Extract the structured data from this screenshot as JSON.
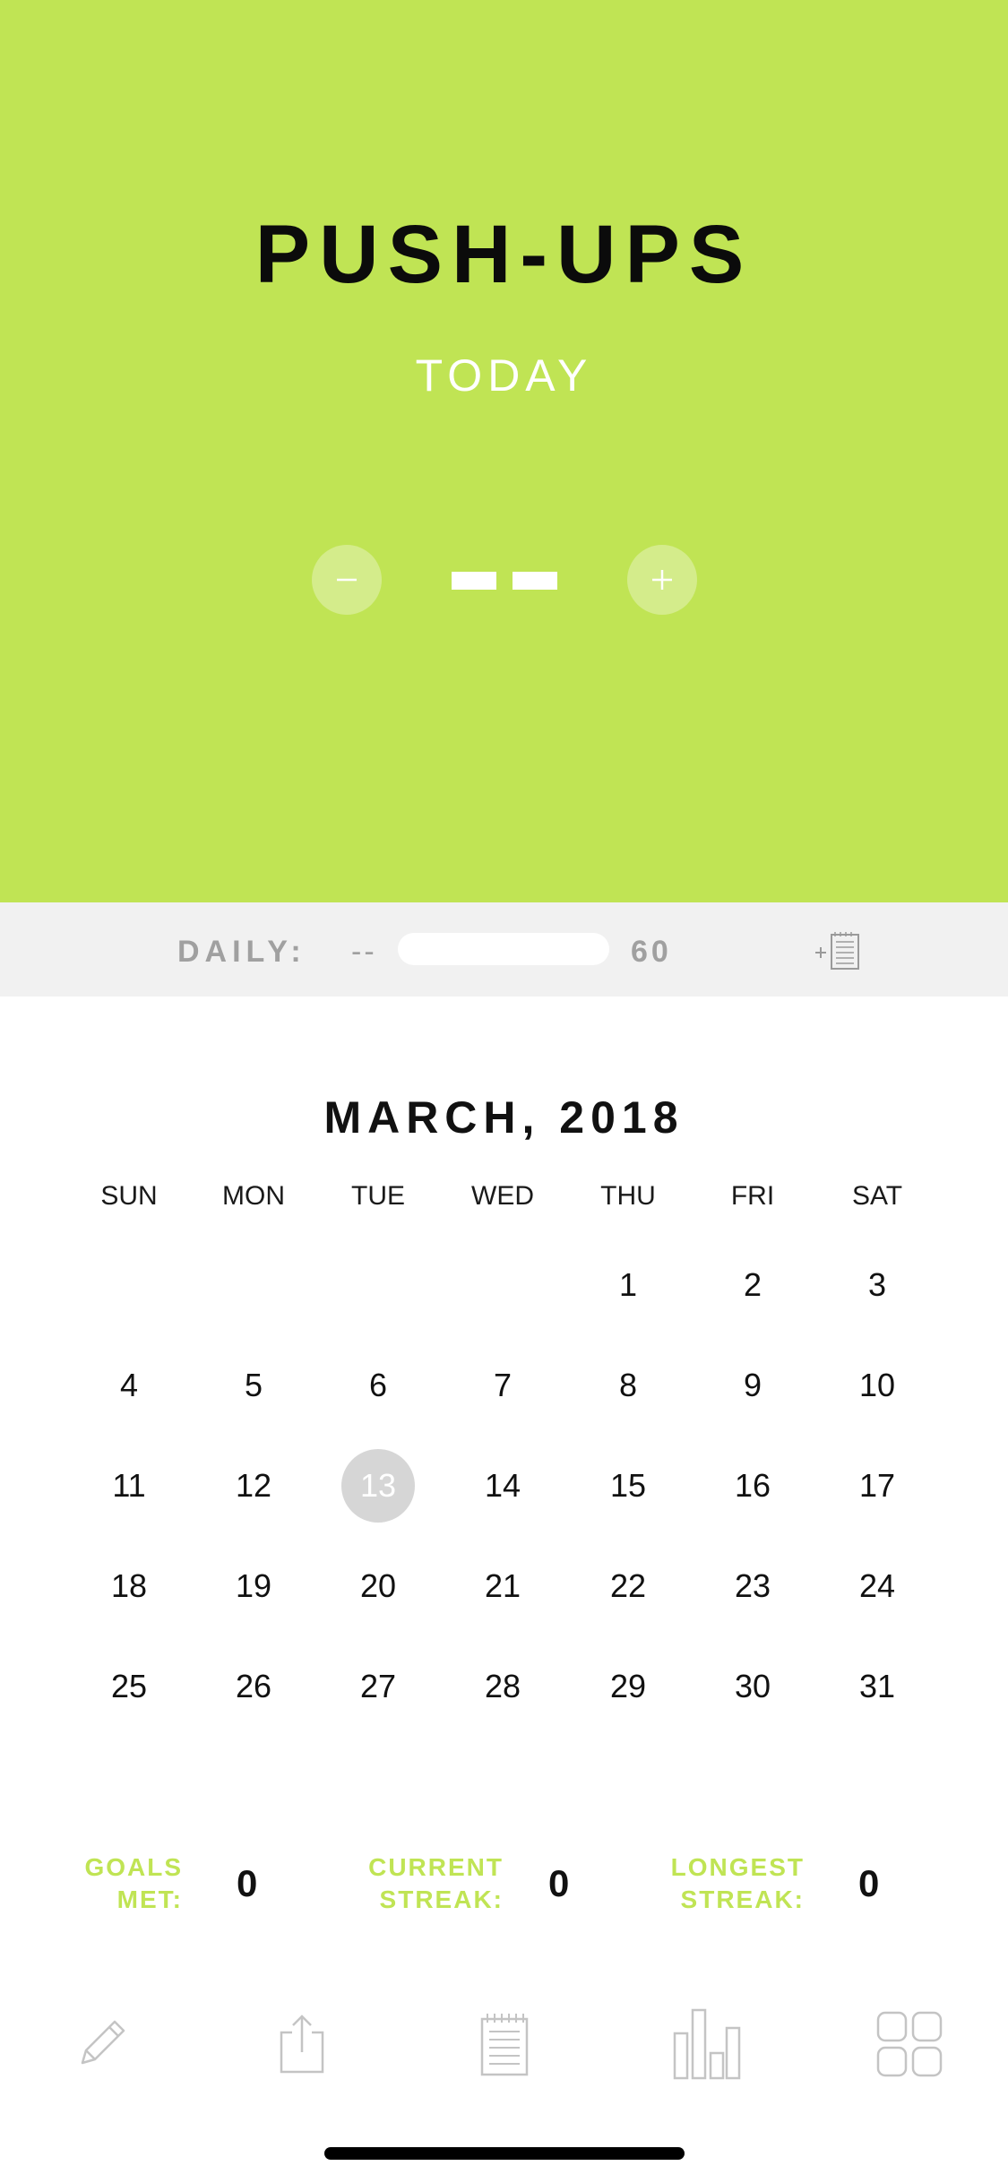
{
  "header": {
    "title": "PUSH-UPS",
    "subtitle": "TODAY",
    "count_display": "--",
    "decrement_icon": "minus-icon",
    "increment_icon": "plus-icon"
  },
  "goal_bar": {
    "label": "DAILY:",
    "current": "--",
    "target": "60",
    "add_note_icon": "add-note-icon"
  },
  "calendar": {
    "month_title": "MARCH, 2018",
    "weekdays": [
      "SUN",
      "MON",
      "TUE",
      "WED",
      "THU",
      "FRI",
      "SAT"
    ],
    "selected_day": "13",
    "weeks": [
      [
        "",
        "",
        "",
        "",
        "1",
        "2",
        "3"
      ],
      [
        "4",
        "5",
        "6",
        "7",
        "8",
        "9",
        "10"
      ],
      [
        "11",
        "12",
        "13",
        "14",
        "15",
        "16",
        "17"
      ],
      [
        "18",
        "19",
        "20",
        "21",
        "22",
        "23",
        "24"
      ],
      [
        "25",
        "26",
        "27",
        "28",
        "29",
        "30",
        "31"
      ]
    ]
  },
  "stats": {
    "goals_met": {
      "label_line1": "GOALS",
      "label_line2": "MET:",
      "value": "0"
    },
    "current_streak": {
      "label_line1": "CURRENT",
      "label_line2": "STREAK:",
      "value": "0"
    },
    "longest_streak": {
      "label_line1": "LONGEST",
      "label_line2": "STREAK:",
      "value": "0"
    }
  },
  "tabbar": {
    "items": [
      {
        "icon": "pencil-icon"
      },
      {
        "icon": "share-icon"
      },
      {
        "icon": "notes-icon"
      },
      {
        "icon": "bar-chart-icon"
      },
      {
        "icon": "grid-icon"
      }
    ]
  },
  "colors": {
    "accent": "#c0e454",
    "panel": "#f1f1f1",
    "muted_text": "#a0a0a0",
    "selected_day": "#d6d6d6"
  }
}
